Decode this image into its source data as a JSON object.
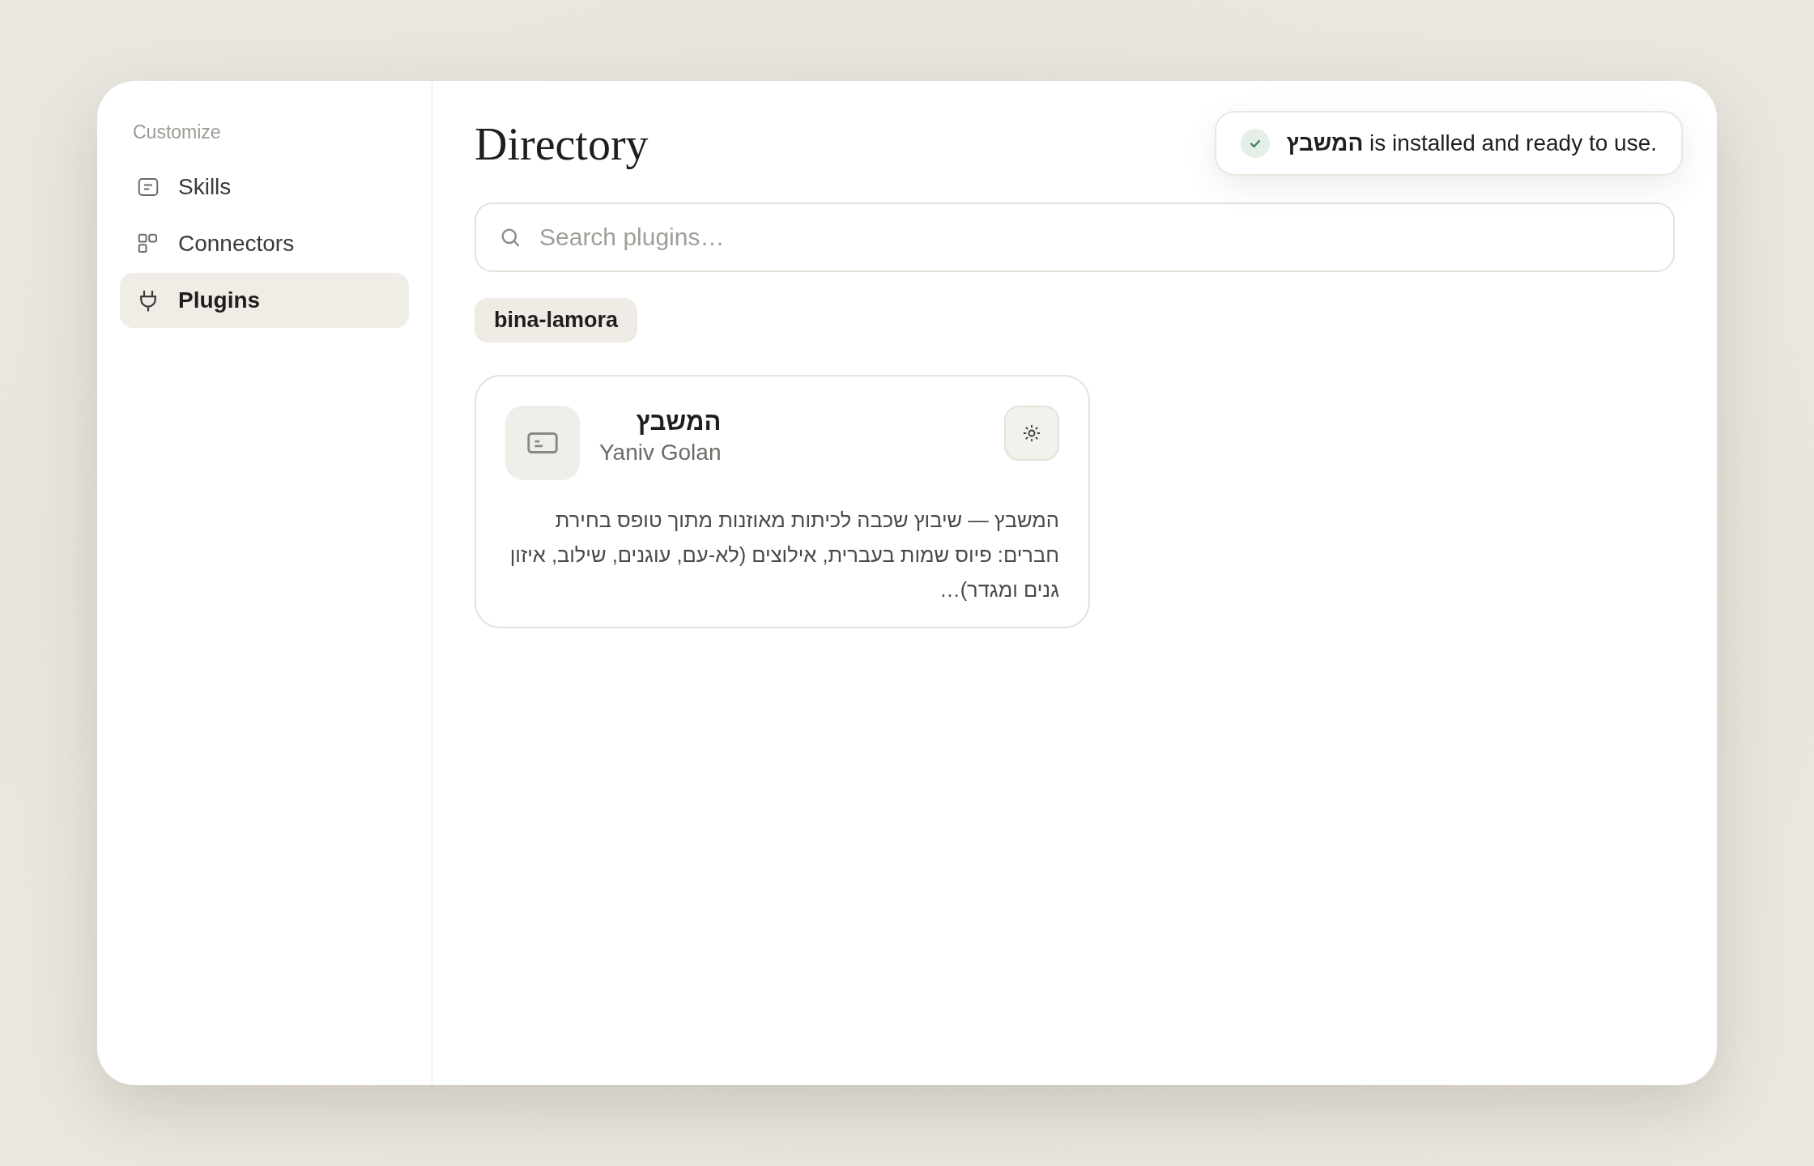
{
  "sidebar": {
    "heading": "Customize",
    "items": [
      {
        "label": "Skills",
        "selected": false
      },
      {
        "label": "Connectors",
        "selected": false
      },
      {
        "label": "Plugins",
        "selected": true
      }
    ]
  },
  "main": {
    "title": "Directory",
    "search": {
      "placeholder": "Search plugins…"
    },
    "filters": [
      {
        "label": "bina-lamora",
        "selected": true
      }
    ],
    "plugins": [
      {
        "name": "המשבץ",
        "author": "Yaniv Golan",
        "description": "המשבץ — שיבוץ שכבה לכיתות מאוזנות מתוך טופס בחירת חברים: פיוס שמות בעברית, אילוצים (לא-עם, עוגנים, שילוב, איזון גנים ומגדר)…"
      }
    ]
  },
  "toast": {
    "message": "**המשבץ** is installed and ready to use."
  }
}
